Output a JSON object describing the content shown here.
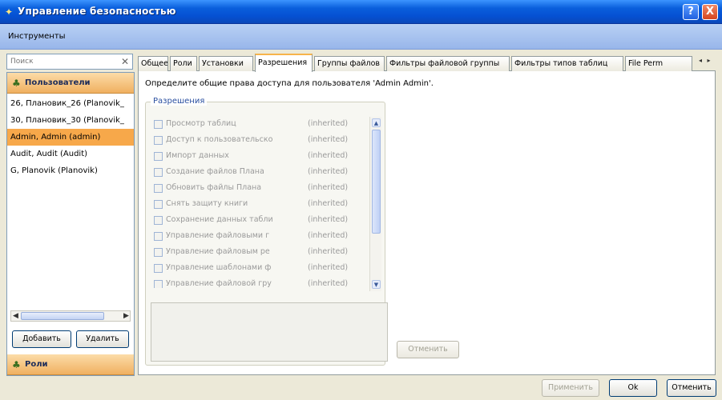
{
  "window": {
    "title": "Управление безопасностью",
    "help_label": "?",
    "close_label": "X"
  },
  "menu": {
    "items": [
      {
        "label": "Инструменты"
      }
    ]
  },
  "search": {
    "placeholder": "Поиск",
    "value": ""
  },
  "sidebar": {
    "users_header": "Пользователи",
    "roles_header": "Роли",
    "users": [
      {
        "label": "26, Плановик_26 (Planovik_",
        "selected": false
      },
      {
        "label": "30, Плановик_30 (Planovik_",
        "selected": false
      },
      {
        "label": "Admin, Admin (admin)",
        "selected": true
      },
      {
        "label": "Audit, Audit (Audit)",
        "selected": false
      },
      {
        "label": "G, Planovik (Planovik)",
        "selected": false
      }
    ],
    "add_button": "Добавить",
    "delete_button": "Удалить"
  },
  "tabs": [
    {
      "label": "Общее",
      "active": false
    },
    {
      "label": "Роли",
      "active": false
    },
    {
      "label": "Установки",
      "active": false
    },
    {
      "label": "Разрешения",
      "active": true
    },
    {
      "label": "Группы файлов",
      "active": false
    },
    {
      "label": "Фильтры файловой группы",
      "active": false
    },
    {
      "label": "Фильтры типов таблиц",
      "active": false
    },
    {
      "label": "File Perm",
      "active": false
    }
  ],
  "tab_scroll_label": "◂ ▸",
  "permissions": {
    "description": "Определите общие права доступа для пользователя 'Admin Admin'.",
    "group_title": "Разрешения",
    "items": [
      {
        "label": "Просмотр таблиц",
        "status": "(inherited)"
      },
      {
        "label": "Доступ к пользовательско",
        "status": "(inherited)"
      },
      {
        "label": "Импорт данных",
        "status": "(inherited)"
      },
      {
        "label": "Создание файлов Плана",
        "status": "(inherited)"
      },
      {
        "label": "Обновить файлы Плана",
        "status": "(inherited)"
      },
      {
        "label": "Снять защиту книги",
        "status": "(inherited)"
      },
      {
        "label": "Сохранение данных табли",
        "status": "(inherited)"
      },
      {
        "label": "Управление файловыми г",
        "status": "(inherited)"
      },
      {
        "label": "Управление файловым ре",
        "status": "(inherited)"
      },
      {
        "label": "Управление шаблонами ф",
        "status": "(inherited)"
      },
      {
        "label": "Управление файловой гру",
        "status": "(inherited)"
      }
    ],
    "cancel_button": "Отменить"
  },
  "footer": {
    "apply_button": "Применить",
    "ok_button": "Ok",
    "cancel_button": "Отменить"
  },
  "colors": {
    "title_blue": "#0550d2",
    "selection_orange": "#f7a84a",
    "section_header": "#f0b060",
    "active_tab_accent": "#f7b44a"
  }
}
